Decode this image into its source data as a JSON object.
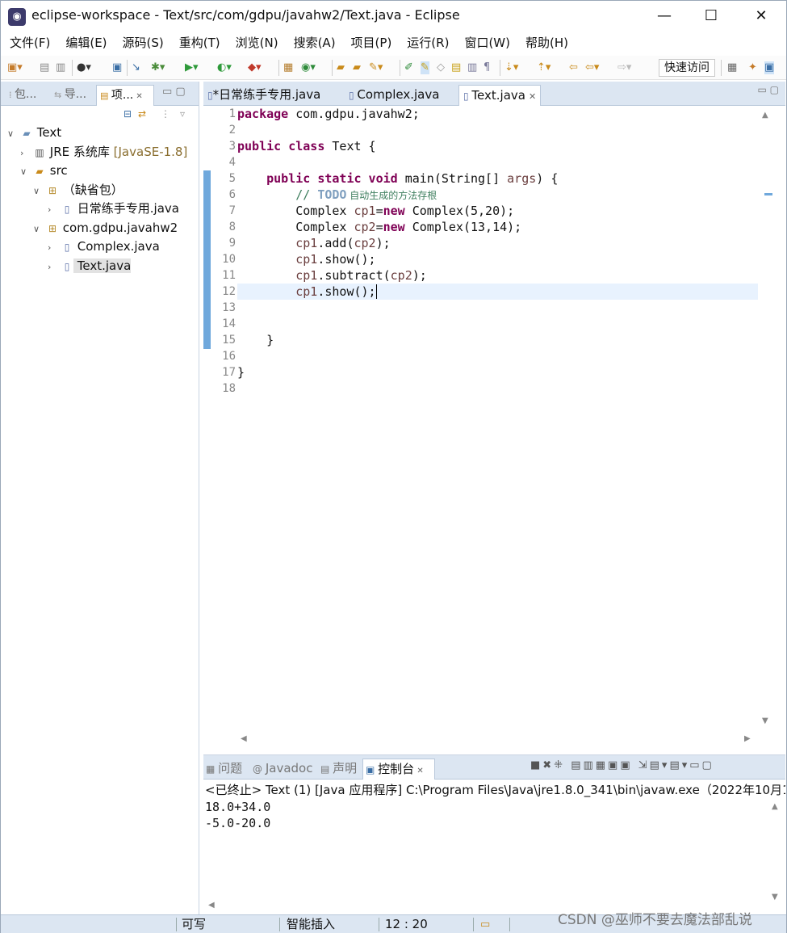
{
  "window": {
    "title": "eclipse-workspace - Text/src/com/gdpu/javahw2/Text.java - Eclipse",
    "minimize": "—",
    "maximize": "☐",
    "close": "✕"
  },
  "menu": [
    "文件(F)",
    "编辑(E)",
    "源码(S)",
    "重构(T)",
    "浏览(N)",
    "搜索(A)",
    "项目(P)",
    "运行(R)",
    "窗口(W)",
    "帮助(H)"
  ],
  "toolbar": {
    "quick_access": "快速访问"
  },
  "left_panel": {
    "tabs": [
      "包...",
      "导...",
      "项..."
    ],
    "tree": {
      "project": "Text",
      "jre_label": "JRE 系统库",
      "jre_decoration": "[JavaSE-1.8]",
      "src": "src",
      "default_package": "（缺省包）",
      "default_file": "日常练手专用.java",
      "package": "com.gdpu.javahw2",
      "file1": "Complex.java",
      "file2": "Text.java"
    }
  },
  "editor": {
    "tabs": [
      "*日常练手专用.java",
      "Complex.java",
      "Text.java"
    ],
    "line_numbers": [
      "1",
      "2",
      "3",
      "4",
      "5",
      "6",
      "7",
      "8",
      "9",
      "10",
      "11",
      "12",
      "13",
      "14",
      "15",
      "16",
      "17",
      "18"
    ],
    "code": {
      "l1_kw": "package",
      "l1_rest": " com.gdpu.javahw2;",
      "l3_kw": "public class",
      "l3_rest": " Text {",
      "l5_indent": "    ",
      "l5_kw": "public static void",
      "l5_mid": " main(String[] ",
      "l5_var": "args",
      "l5_end": ") {",
      "l6_indent": "        ",
      "l6_comment": "// ",
      "l6_todo": "TODO",
      "l6_text": " 自动生成的方法存根",
      "l7_a": "        Complex ",
      "l7_var": "cp1",
      "l7_eq": "=",
      "l7_kw": "new",
      "l7_end": " Complex(5,20);",
      "l8_a": "        Complex ",
      "l8_var": "cp2",
      "l8_eq": "=",
      "l8_kw": "new",
      "l8_end": " Complex(13,14);",
      "l9_var": "        cp1",
      "l9_mid": ".add(",
      "l9_arg": "cp2",
      "l9_end": ");",
      "l10_var": "        cp1",
      "l10_end": ".show();",
      "l11_var": "        cp1",
      "l11_mid": ".subtract(",
      "l11_arg": "cp2",
      "l11_end": ");",
      "l12_var": "        cp1",
      "l12_end": ".show();",
      "l15": "    }",
      "l17": "}"
    }
  },
  "console": {
    "tabs": [
      "问题",
      "Javadoc",
      "声明",
      "控制台"
    ],
    "header": "<已终止> Text (1) [Java 应用程序] C:\\Program Files\\Java\\jre1.8.0_341\\bin\\javaw.exe（2022年10月1",
    "output": [
      "18.0+34.0",
      "-5.0-20.0"
    ]
  },
  "status": {
    "writable": "可写",
    "insert_mode": "智能插入",
    "position": "12 : 20"
  },
  "watermark": "CSDN @巫师不要去魔法部乱说"
}
